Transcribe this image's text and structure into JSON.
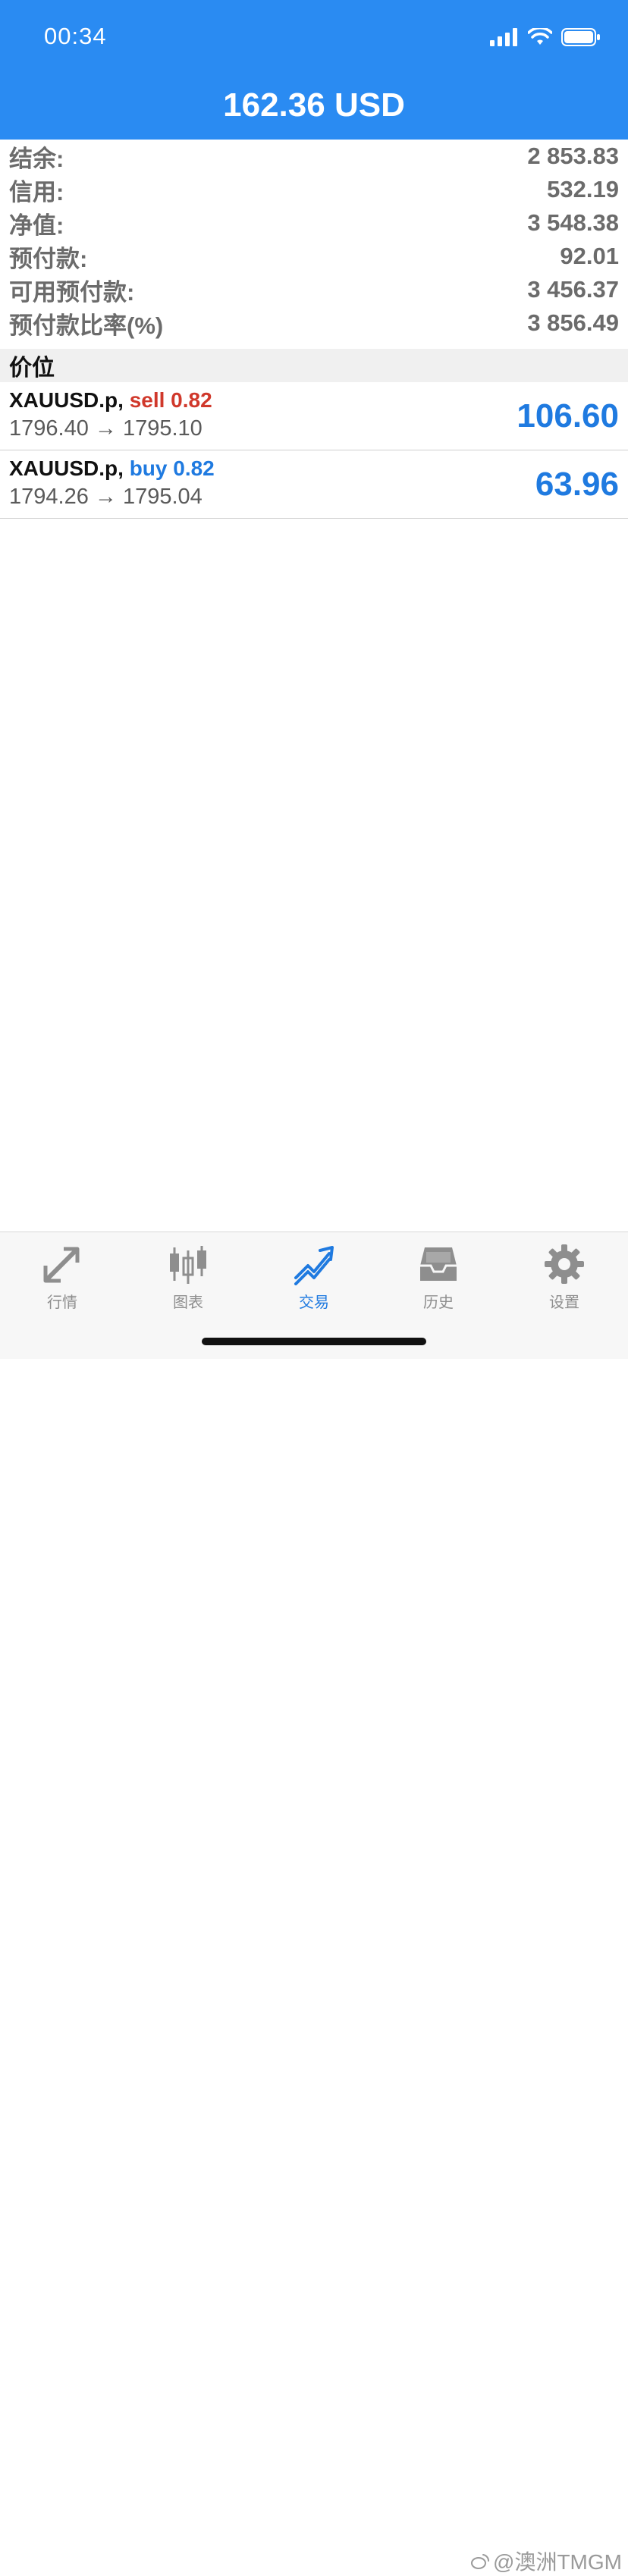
{
  "status_bar": {
    "time": "00:34"
  },
  "header": {
    "title": "162.36 USD",
    "accent_color": "#2a8bf2"
  },
  "summary": [
    {
      "label": "结余:",
      "value": "2 853.83"
    },
    {
      "label": "信用:",
      "value": "532.19"
    },
    {
      "label": "净值:",
      "value": "3 548.38"
    },
    {
      "label": "预付款:",
      "value": "92.01"
    },
    {
      "label": "可用预付款:",
      "value": "3 456.37"
    },
    {
      "label": "预付款比率(%)",
      "value": "3 856.49"
    }
  ],
  "positions_section": {
    "title": "价位"
  },
  "positions": [
    {
      "symbol": "XAUUSD.p,",
      "side_volume": "sell 0.82",
      "side": "sell",
      "prices": "1796.40 → 1795.10",
      "profit": "106.60"
    },
    {
      "symbol": "XAUUSD.p,",
      "side_volume": "buy 0.82",
      "side": "buy",
      "prices": "1794.26 → 1795.04",
      "profit": "63.96"
    }
  ],
  "tabbar": {
    "tabs": [
      {
        "label": "行情",
        "icon": "quotes-arrows-icon",
        "active": false
      },
      {
        "label": "图表",
        "icon": "candlestick-chart-icon",
        "active": false
      },
      {
        "label": "交易",
        "icon": "trade-trend-icon",
        "active": true
      },
      {
        "label": "历史",
        "icon": "history-inbox-icon",
        "active": false
      },
      {
        "label": "设置",
        "icon": "gear-icon",
        "active": false
      }
    ],
    "active_color": "#1f7ae0",
    "inactive_color": "#8e8e8e"
  },
  "watermark": {
    "text": "@澳洲TMGM"
  },
  "colors": {
    "sell": "#d0382b",
    "buy": "#1f7ae0"
  }
}
